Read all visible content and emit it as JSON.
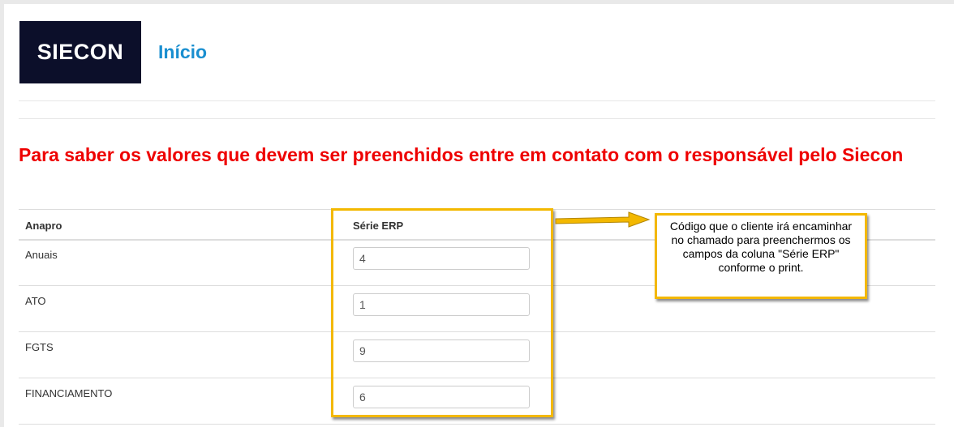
{
  "header": {
    "logo_text": "SIECON",
    "title": "Início"
  },
  "notice": "Para saber os valores que devem ser preenchidos entre em contato com o responsável pelo Siecon",
  "table": {
    "headers": [
      "Anapro",
      "Série ERP"
    ],
    "rows": [
      {
        "label": "Anuais",
        "value": "4"
      },
      {
        "label": "ATO",
        "value": "1"
      },
      {
        "label": "FGTS",
        "value": "9"
      },
      {
        "label": "FINANCIAMENTO",
        "value": "6"
      }
    ]
  },
  "annotation": {
    "text": "Código que o cliente irá encaminhar no chamado para preenchermos os campos da coluna \"Série ERP\" conforme o print."
  },
  "colors": {
    "accent_link": "#1a8fd0",
    "notice_red": "#ee0000",
    "highlight": "#f3b800",
    "logo_bg": "#0c0f2a"
  }
}
